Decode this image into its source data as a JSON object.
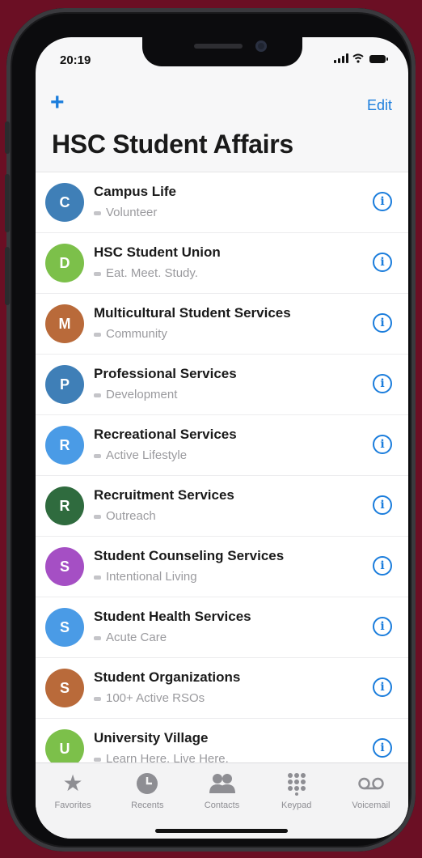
{
  "status_bar": {
    "time": "20:19"
  },
  "nav": {
    "add_label": "+",
    "edit_label": "Edit",
    "title": "HSC Student Affairs"
  },
  "contacts": [
    {
      "initial": "C",
      "name": "Campus Life",
      "subtitle": "Volunteer",
      "color": "#3f7fb7"
    },
    {
      "initial": "D",
      "name": "HSC Student Union",
      "subtitle": "Eat. Meet. Study.",
      "color": "#7cc04a"
    },
    {
      "initial": "M",
      "name": "Multicultural Student Services",
      "subtitle": "Community",
      "color": "#b96a3a"
    },
    {
      "initial": "P",
      "name": "Professional Services",
      "subtitle": "Development",
      "color": "#3f7fb7"
    },
    {
      "initial": "R",
      "name": "Recreational Services",
      "subtitle": "Active Lifestyle",
      "color": "#4a9be6"
    },
    {
      "initial": "R",
      "name": "Recruitment Services",
      "subtitle": "Outreach",
      "color": "#2f6b3e"
    },
    {
      "initial": "S",
      "name": "Student Counseling Services",
      "subtitle": "Intentional Living",
      "color": "#a54fc4"
    },
    {
      "initial": "S",
      "name": "Student Health Services",
      "subtitle": "Acute Care",
      "color": "#4a9be6"
    },
    {
      "initial": "S",
      "name": "Student Organizations",
      "subtitle": "100+ Active RSOs",
      "color": "#b96a3a"
    },
    {
      "initial": "U",
      "name": "University Village",
      "subtitle": "Learn Here. Live Here.",
      "color": "#7cc04a"
    }
  ],
  "tabs": [
    {
      "label": "Favorites",
      "icon": "star-icon"
    },
    {
      "label": "Recents",
      "icon": "clock-icon"
    },
    {
      "label": "Contacts",
      "icon": "people-icon"
    },
    {
      "label": "Keypad",
      "icon": "keypad-icon"
    },
    {
      "label": "Voicemail",
      "icon": "voicemail-icon"
    }
  ],
  "colors": {
    "accent": "#1b7ddc",
    "background": "#6b0f24"
  }
}
